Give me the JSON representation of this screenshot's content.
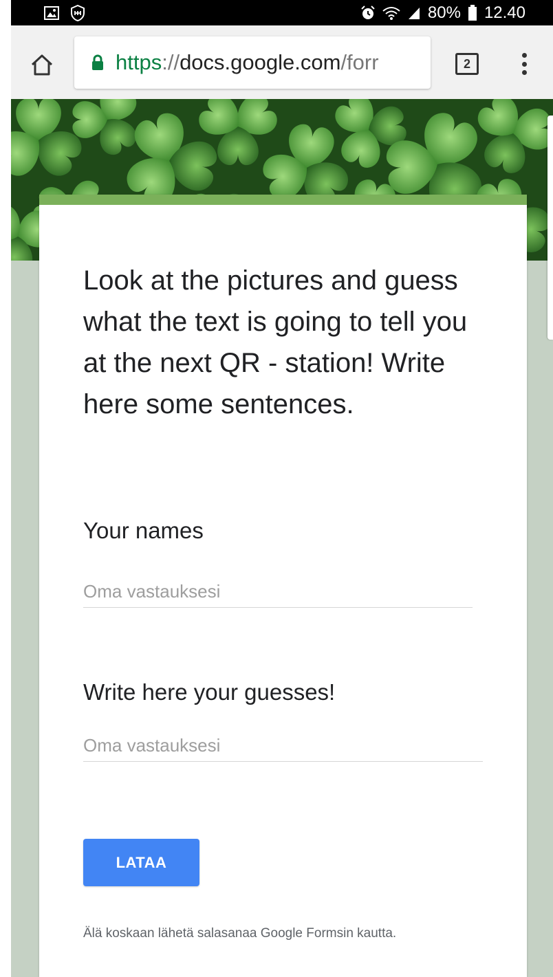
{
  "status_bar": {
    "left_icons": [
      "image-icon",
      "shield-icon"
    ],
    "right_icons": [
      "alarm-icon",
      "wifi-icon",
      "signal-icon"
    ],
    "battery_percent": "80%",
    "time": "12.40"
  },
  "browser": {
    "url_scheme": "https",
    "url_sep": "://",
    "url_host": "docs.google.com",
    "url_path": "/forr",
    "tab_count": "2"
  },
  "form": {
    "title": "Look at the pictures and guess what the text is going to tell you at the next QR - station! Write here some sentences.",
    "questions": [
      {
        "label": "Your names",
        "placeholder": "Oma vastauksesi",
        "value": ""
      },
      {
        "label": "Write here your guesses!",
        "placeholder": "Oma vastauksesi",
        "value": ""
      }
    ],
    "submit_label": "LATAA",
    "footer_note": "Älä koskaan lähetä salasanaa Google Formsin kautta."
  },
  "colors": {
    "accent_green": "#7bb05a",
    "page_background": "#c5d1c4",
    "submit_blue": "#4285f4",
    "secure_green": "#0b8043"
  }
}
